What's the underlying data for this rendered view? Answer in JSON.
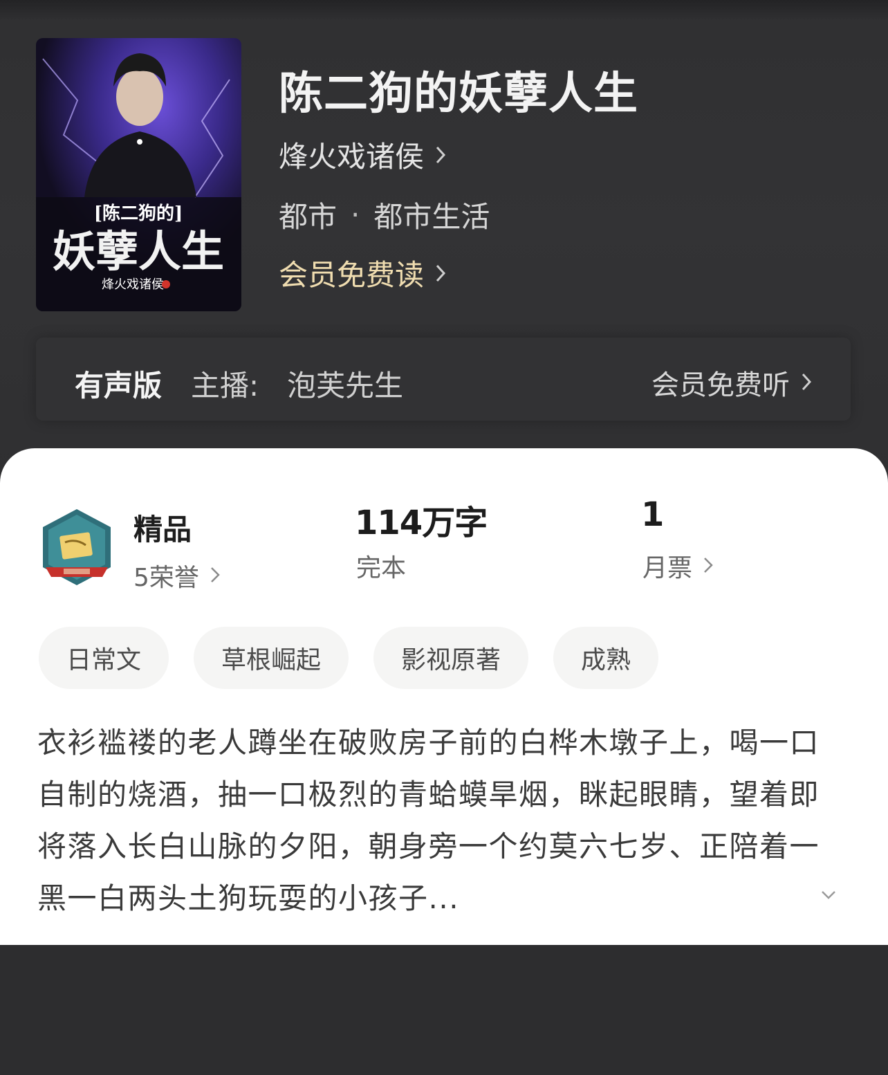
{
  "book": {
    "title": "陈二狗的妖孽人生",
    "author": "烽火戏诸侯",
    "category": "都市",
    "category_separator": "·",
    "subcategory": "都市生活",
    "free_read": "会员免费读"
  },
  "cover": {
    "subtitle_text": "[陈二狗的]",
    "main_text": "妖孽人生",
    "author_text": "烽火戏诸侯"
  },
  "audio": {
    "label": "有声版",
    "host_label": "主播:",
    "host_name": "泡芙先生",
    "listen_label": "会员免费听"
  },
  "stats": {
    "quality_title": "精品",
    "honors": "5荣誉",
    "word_count": "114万字",
    "status": "完本",
    "monthly_votes": "1",
    "votes_label": "月票"
  },
  "tags": [
    "日常文",
    "草根崛起",
    "影视原著",
    "成熟"
  ],
  "synopsis": "衣衫褴褛的老人蹲坐在破败房子前的白桦木墩子上，喝一口自制的烧酒，抽一口极烈的青蛤蟆旱烟，眯起眼睛，望着即将落入长白山脉的夕阳，朝身旁一个约莫六七岁、正陪着一黑一白两头土狗玩耍的小孩子...",
  "colors": {
    "header_bg": "#333335",
    "accent_gold": "#f0ddb0",
    "card_bg": "#ffffff",
    "tag_bg": "#f5f5f4"
  },
  "icons": {
    "chevron": "chevron-right-icon",
    "badge": "quality-badge-icon",
    "expand": "chevron-down-icon"
  }
}
